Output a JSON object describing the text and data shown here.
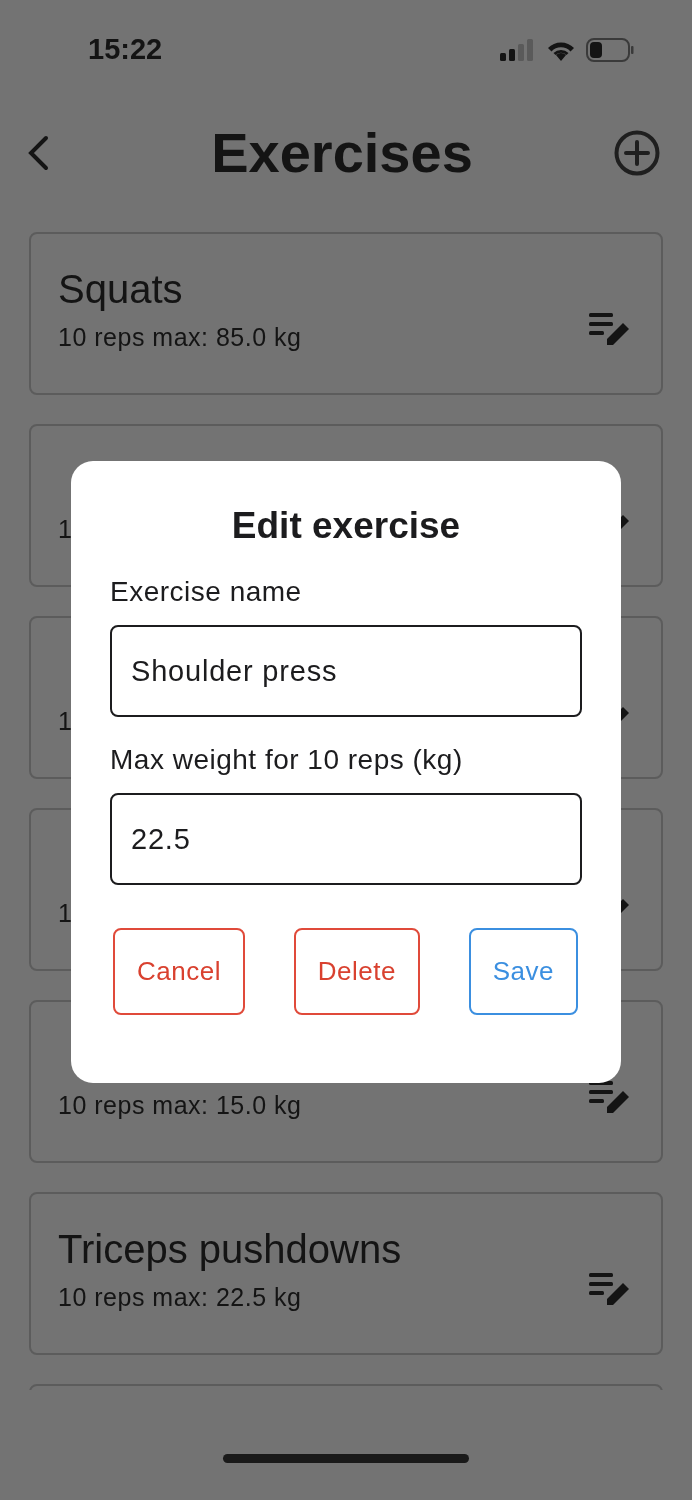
{
  "status_bar": {
    "time": "15:22"
  },
  "header": {
    "title": "Exercises"
  },
  "exercises": [
    {
      "kind": "exercise",
      "name": "Squats",
      "detail": "10 reps max: 85.0 kg"
    },
    {
      "kind": "exercise",
      "detail": "1"
    },
    {
      "kind": "exercise",
      "detail": "1"
    },
    {
      "kind": "exercise",
      "detail": "1"
    },
    {
      "kind": "exercise",
      "detail": "10 reps max: 15.0 kg"
    },
    {
      "kind": "exercise",
      "name": "Triceps pushdowns",
      "detail": "10 reps max: 22.5 kg"
    },
    {
      "kind": "cut_off"
    }
  ],
  "dialog": {
    "title": "Edit exercise",
    "fields": [
      {
        "label": "Exercise name",
        "value": "Shoulder press"
      },
      {
        "label": "Max weight for 10 reps (kg)",
        "value": "22.5"
      }
    ],
    "buttons": [
      {
        "label": "Cancel",
        "kind": "danger"
      },
      {
        "label": "Delete",
        "kind": "danger"
      },
      {
        "label": "Save",
        "kind": "primary"
      }
    ]
  }
}
